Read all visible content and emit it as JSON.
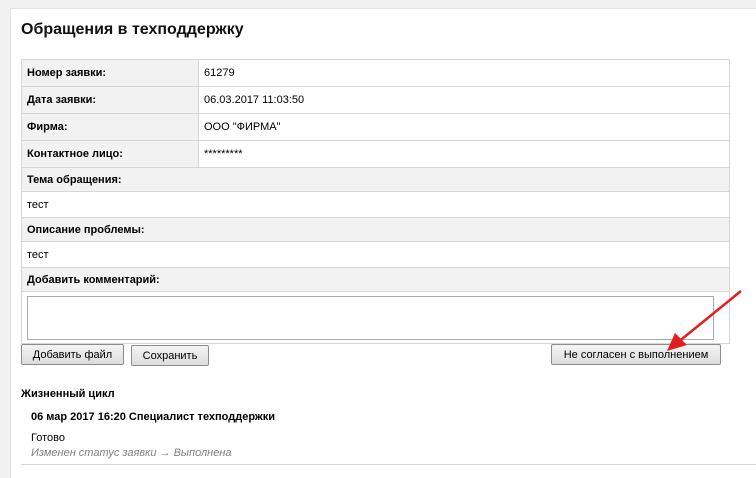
{
  "page": {
    "title": "Обращения в техподдержку"
  },
  "ticket": {
    "rows": [
      {
        "label": "Номер заявки:",
        "value": "61279"
      },
      {
        "label": "Дата заявки:",
        "value": "06.03.2017 11:03:50"
      },
      {
        "label": "Фирма:",
        "value": "ООО \"ФИРМА\""
      },
      {
        "label": "Контактное лицо:",
        "value": "*********"
      }
    ],
    "subject_label": "Тема обращения:",
    "subject_value": "тест",
    "description_label": "Описание проблемы:",
    "description_value": "тест",
    "comment_label": "Добавить комментарий:",
    "comment_value": ""
  },
  "buttons": {
    "add_file": "Добавить файл",
    "save": "Сохранить",
    "disagree": "Не согласен с выполнением"
  },
  "lifecycle": {
    "title": "Жизненный цикл",
    "events": [
      {
        "header": "06 мар 2017 16:20 Специалист техподдержки",
        "status": "Готово",
        "change": "Изменен статус заявки → Выполнена"
      }
    ]
  },
  "colors": {
    "annotation_arrow": "#e02020"
  }
}
